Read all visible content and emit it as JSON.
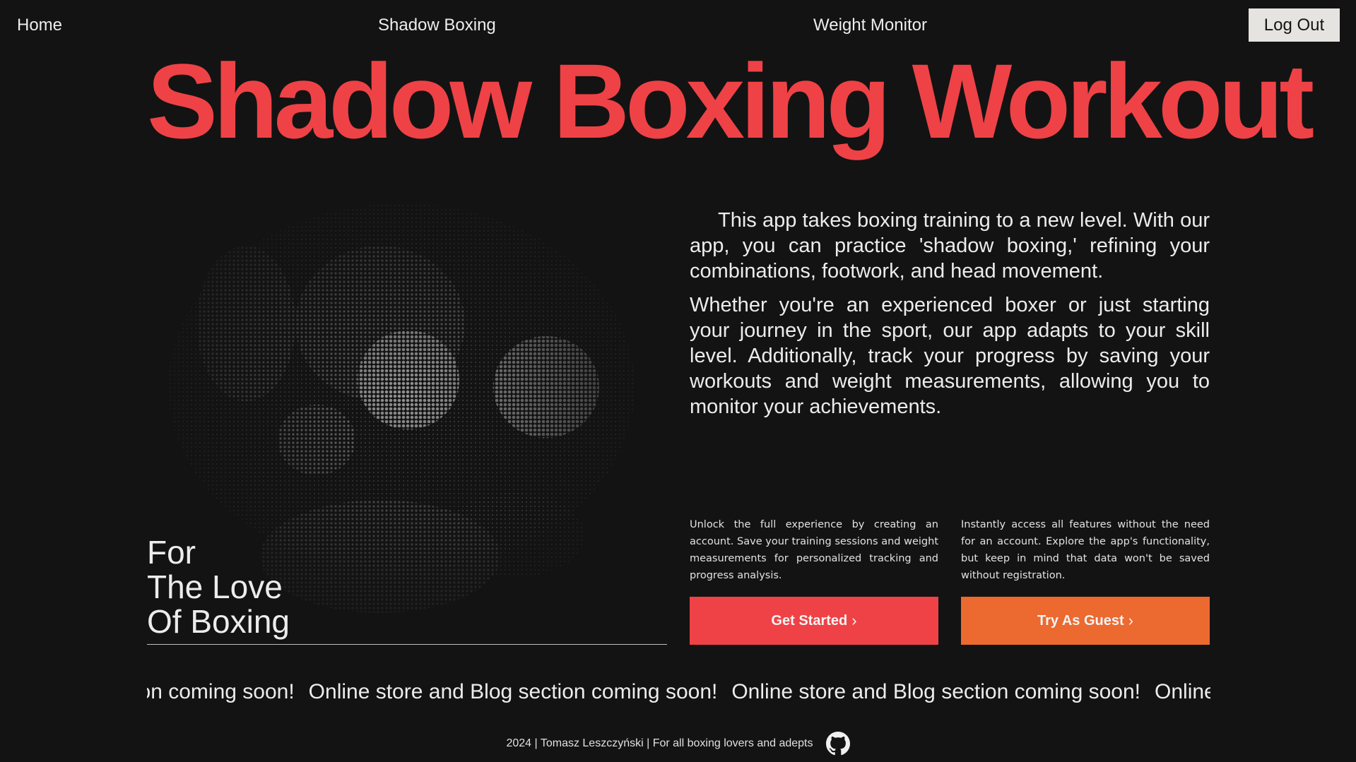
{
  "nav": {
    "home": "Home",
    "shadow_boxing": "Shadow Boxing",
    "weight_monitor": "Weight Monitor",
    "logout": "Log Out"
  },
  "hero": {
    "title": "Shadow Boxing Workout",
    "title_color": "#ef4246"
  },
  "image": {
    "icon": "boxer-halftone-image",
    "tagline": [
      "For",
      "The Love",
      "Of Boxing"
    ]
  },
  "description": {
    "paragraph1": "This app takes boxing training to a new level. With our app, you can practice 'shadow boxing,' refining your combinations, footwork, and head movement.",
    "paragraph2": "Whether you're an experienced boxer or just starting your journey in the sport, our app adapts to your skill level. Additionally, track your progress by saving your workouts and weight measurements, allowing you to monitor your achievements."
  },
  "cta": {
    "left_text": "Unlock the full experience by creating an account. Save your training sessions and weight measurements for personalized tracking and progress analysis.",
    "left_button": "Get Started",
    "left_color": "#ef4246",
    "right_text": "Instantly access all features without the need for an account. Explore the app's functionality, but keep in mind that data won't be saved without registration.",
    "right_button": "Try As Guest",
    "right_color": "#ec6930",
    "chevron": "›"
  },
  "marquee": {
    "text": "Online store and Blog section coming soon!"
  },
  "footer": {
    "text": "2024 | Tomasz Leszczyński | For all boxing lovers and adepts",
    "icon": "github-icon"
  }
}
